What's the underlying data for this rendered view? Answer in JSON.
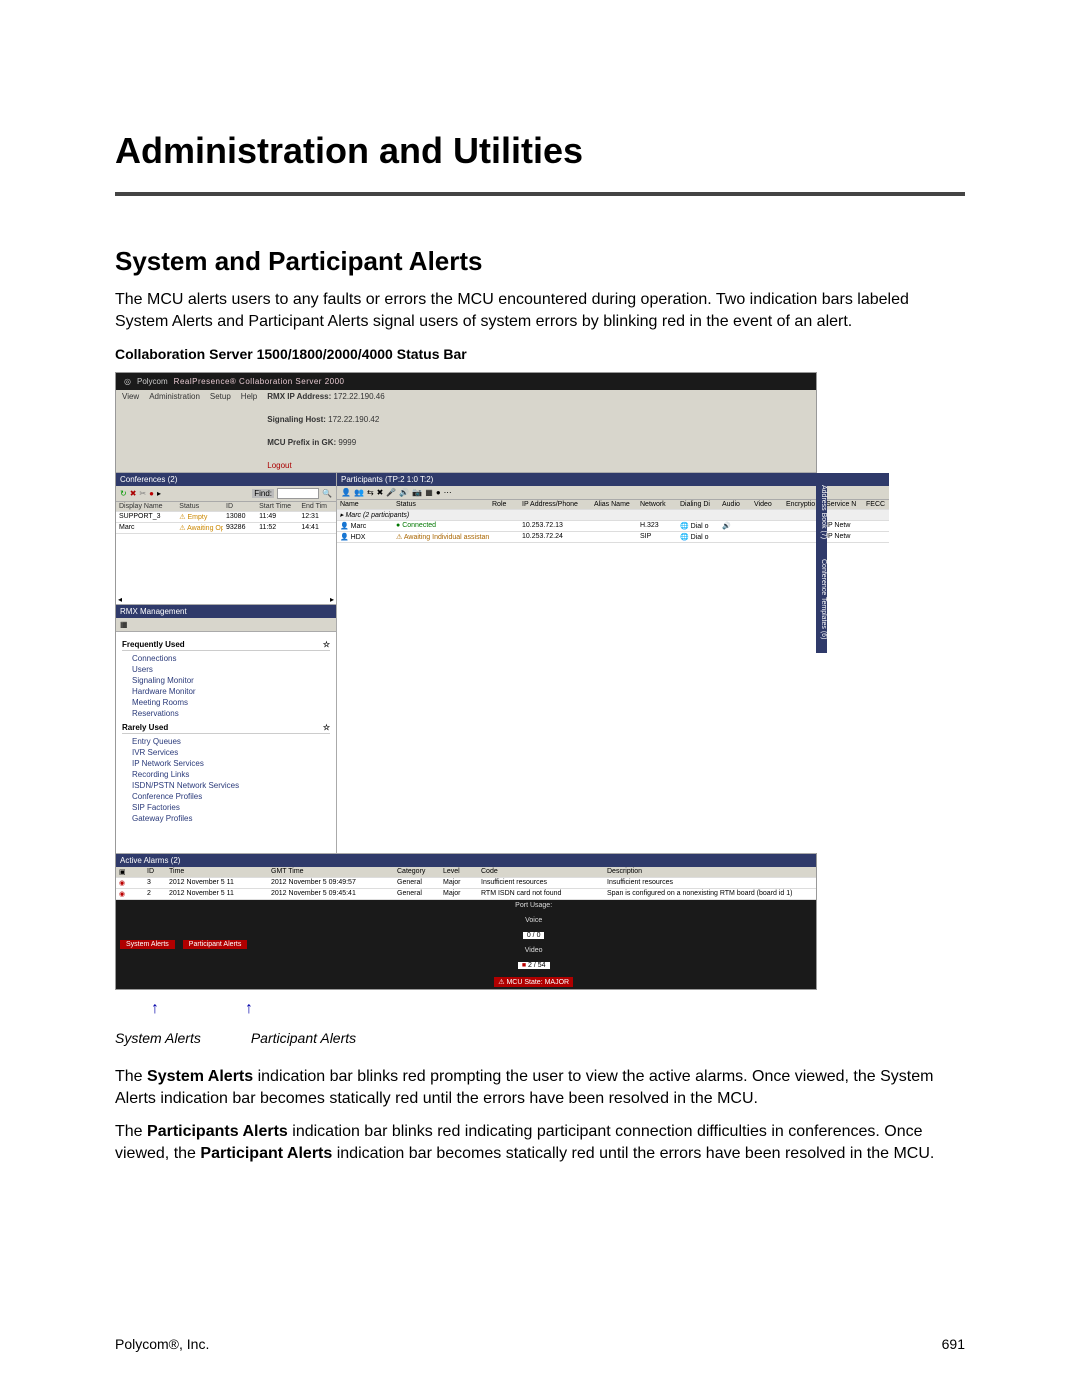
{
  "doc": {
    "h1": "Administration and Utilities",
    "h2": "System and Participant Alerts",
    "p1": "The MCU alerts users to any faults or errors the MCU encountered during operation. Two indication bars labeled System Alerts and Participant Alerts signal users of system errors by blinking red in the event of an alert.",
    "caption": "Collaboration Server 1500/1800/2000/4000 Status Bar",
    "p2a": "The ",
    "p2b": "System Alerts",
    "p2c": " indication bar blinks red prompting the user to view the active alarms. Once viewed, the System Alerts indication bar becomes statically red until the errors have been resolved in the MCU.",
    "p3a": "The ",
    "p3b": "Participants Alerts",
    "p3c": " indication bar blinks red indicating participant connection difficulties in conferences. Once viewed, the ",
    "p3d": "Participant Alerts",
    "p3e": " indication bar becomes statically red until the errors have been resolved in the MCU.",
    "lbl_sa": "System Alerts",
    "lbl_pa": "Participant Alerts",
    "footer_left": "Polycom®, Inc.",
    "footer_right": "691"
  },
  "shot": {
    "brand": "Polycom",
    "title": "RealPresence® Collaboration Server 2000",
    "menu": [
      "View",
      "Administration",
      "Setup",
      "Help"
    ],
    "info": {
      "rmx_ip_lbl": "RMX IP Address:",
      "rmx_ip": "172.22.190.46",
      "sig_lbl": "Signaling Host:",
      "sig": "172.22.190.42",
      "prefix_lbl": "MCU Prefix in GK:",
      "prefix": "9999",
      "logout": "Logout"
    },
    "conf_head": "Conferences (2)",
    "find": "Find:",
    "conf_cols": [
      "Display Name",
      "Status",
      "ID",
      "Start Time",
      "End Tim"
    ],
    "conf_rows": [
      {
        "name": "SUPPORT_3",
        "status": "Empty",
        "id": "13080",
        "start": "11:49",
        "end": "12:31"
      },
      {
        "name": "Marc",
        "status": "Awaiting Op",
        "id": "93286",
        "start": "11:52",
        "end": "14:41"
      }
    ],
    "mgmt_head": "RMX Management",
    "freq": "Frequently Used",
    "freq_items": [
      "Connections",
      "Users",
      "Signaling Monitor",
      "Hardware Monitor",
      "Meeting Rooms",
      "Reservations"
    ],
    "rare": "Rarely Used",
    "rare_items": [
      "Entry Queues",
      "IVR Services",
      "IP Network Services",
      "Recording Links",
      "ISDN/PSTN Network Services",
      "Conference Profiles",
      "SIP Factories",
      "Gateway Profiles"
    ],
    "part_head": "Participants (TP:2 1:0 T:2)",
    "part_cols": [
      "Name",
      "Status",
      "Role",
      "IP Address/Phone",
      "Alias Name",
      "Network",
      "Dialing Di",
      "Audio",
      "Video",
      "Encryptio",
      "Service N",
      "FECC"
    ],
    "part_group": "Marc (2 participants)",
    "part_rows": [
      {
        "name": "Marc",
        "status": "Connected",
        "ip": "10.253.72.13",
        "net": "H.323",
        "dial": "Dial o",
        "svc": "IP Netw"
      },
      {
        "name": "HDX",
        "status": "Awaiting Individual assistance",
        "ip": "10.253.72.24",
        "net": "SIP",
        "dial": "Dial o",
        "svc": "IP Netw"
      }
    ],
    "side_tabs": [
      "Address Book (7)",
      "Conference Templates (6)"
    ],
    "alarms_head": "Active Alarms (2)",
    "alarm_cols": [
      "ID",
      "Time",
      "GMT Time",
      "Category",
      "Level",
      "Code",
      "Description"
    ],
    "alarm_rows": [
      {
        "id": "3",
        "time": "2012 November 5 11",
        "gmt": "2012 November 5 09:49:57",
        "cat": "General",
        "lvl": "Major",
        "code": "Insufficient resources",
        "desc": "Insufficient resources"
      },
      {
        "id": "2",
        "time": "2012 November 5 11",
        "gmt": "2012 November 5 09:45:41",
        "cat": "General",
        "lvl": "Major",
        "code": "RTM ISDN card not found",
        "desc": "Span is configured on a nonexisting RTM board (board id 1)"
      }
    ],
    "bottom": {
      "sa": "System Alerts",
      "pa": "Participant Alerts",
      "pu": "Port Usage:",
      "voice": "Voice",
      "voice_v": "0 / 0",
      "video": "Video",
      "video_v": "2 / 54",
      "mcu": "MCU State: MAJOR"
    }
  }
}
